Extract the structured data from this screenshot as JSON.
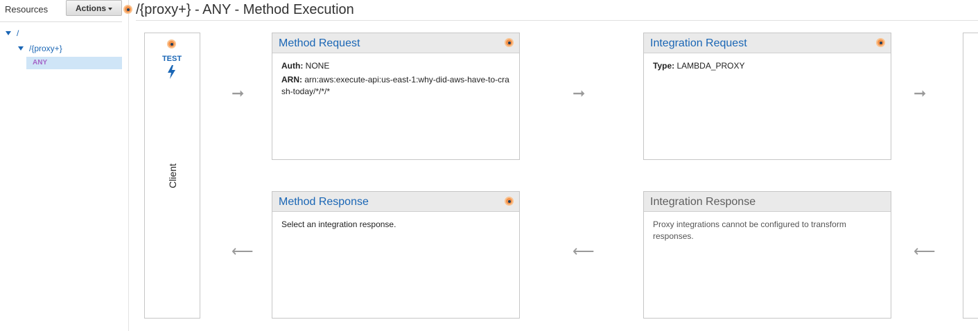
{
  "sidebar": {
    "resources_label": "Resources",
    "actions_label": "Actions",
    "tree": {
      "root": "/",
      "proxy": "/{proxy+}",
      "method": "ANY"
    }
  },
  "header": {
    "title": "/{proxy+} - ANY - Method Execution"
  },
  "client": {
    "test_label": "TEST",
    "label": "Client"
  },
  "method_request": {
    "title": "Method Request",
    "auth_key": "Auth:",
    "auth_value": "NONE",
    "arn_key": "ARN:",
    "arn_value": "arn:aws:execute-api:us-east-1:why-did-aws-have-to-crash-today/*/*/*"
  },
  "integration_request": {
    "title": "Integration Request",
    "type_key": "Type:",
    "type_value": "LAMBDA_PROXY"
  },
  "method_response": {
    "title": "Method Response",
    "text": "Select an integration response."
  },
  "integration_response": {
    "title": "Integration Response",
    "text": "Proxy integrations cannot be configured to transform responses."
  },
  "arrows": {
    "right": "➞",
    "left": "⟵"
  },
  "colors": {
    "link": "#1a66b5",
    "accent_orange": "#f4924a",
    "method_purple": "#a566c8",
    "selected_bg": "#cfe5f7"
  }
}
